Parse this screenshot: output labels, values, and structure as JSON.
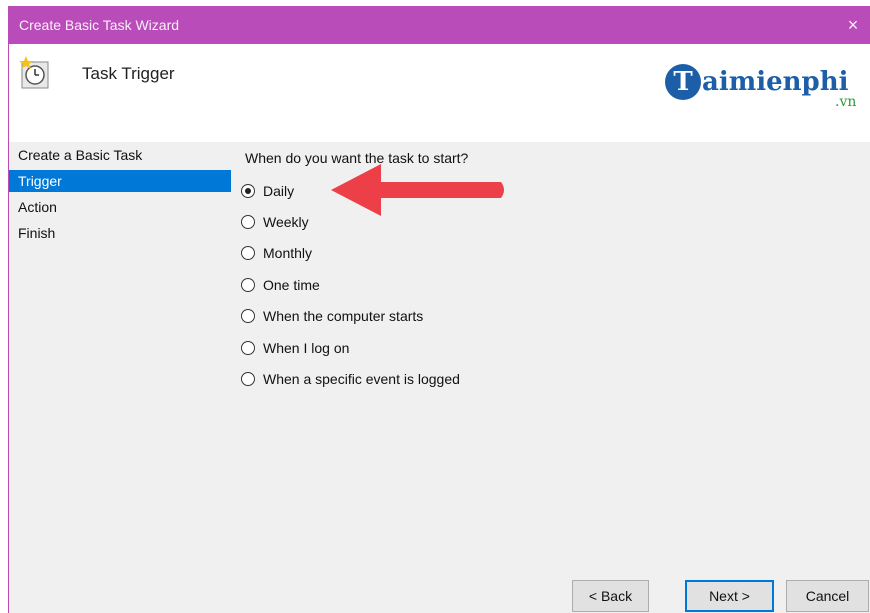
{
  "window": {
    "title": "Create Basic Task Wizard",
    "close_glyph": "×",
    "accent_color": "#b94cb9"
  },
  "header": {
    "heading": "Task Trigger",
    "icon": "clock-wizard-icon"
  },
  "watermark": {
    "logo_letter": "T",
    "logo_text": "aimienphi",
    "logo_suffix": ".vn"
  },
  "sidebar": {
    "steps": [
      {
        "label": "Create a Basic Task",
        "active": false
      },
      {
        "label": "Trigger",
        "active": true
      },
      {
        "label": "Action",
        "active": false
      },
      {
        "label": "Finish",
        "active": false
      }
    ]
  },
  "main": {
    "question": "When do you want the task to start?",
    "options": [
      {
        "label": "Daily",
        "checked": true
      },
      {
        "label": "Weekly",
        "checked": false
      },
      {
        "label": "Monthly",
        "checked": false
      },
      {
        "label": "One time",
        "checked": false
      },
      {
        "label": "When the computer starts",
        "checked": false
      },
      {
        "label": "When I log on",
        "checked": false
      },
      {
        "label": "When a specific event is logged",
        "checked": false
      }
    ]
  },
  "annotation": {
    "arrow_color": "#ec3f48",
    "points_to": "Daily"
  },
  "buttons": {
    "back": "< Back",
    "next": "Next >",
    "cancel": "Cancel"
  }
}
